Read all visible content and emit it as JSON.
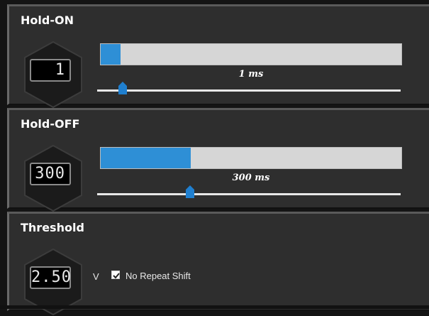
{
  "colors": {
    "accent": "#2e8fd6",
    "panel": "#2e2e2e",
    "track": "#d6d6d6"
  },
  "hold_on": {
    "title": "Hold-ON",
    "display": "1",
    "value_label": "1 ms",
    "bar_fraction": 0.065,
    "slider_fraction": 0.085
  },
  "hold_off": {
    "title": "Hold-OFF",
    "display": "300",
    "value_label": "300 ms",
    "bar_fraction": 0.3,
    "slider_fraction": 0.305
  },
  "threshold": {
    "title": "Threshold",
    "display": "2.50",
    "unit": "V",
    "checkbox_label": "No Repeat Shift",
    "checkbox_checked": true
  }
}
